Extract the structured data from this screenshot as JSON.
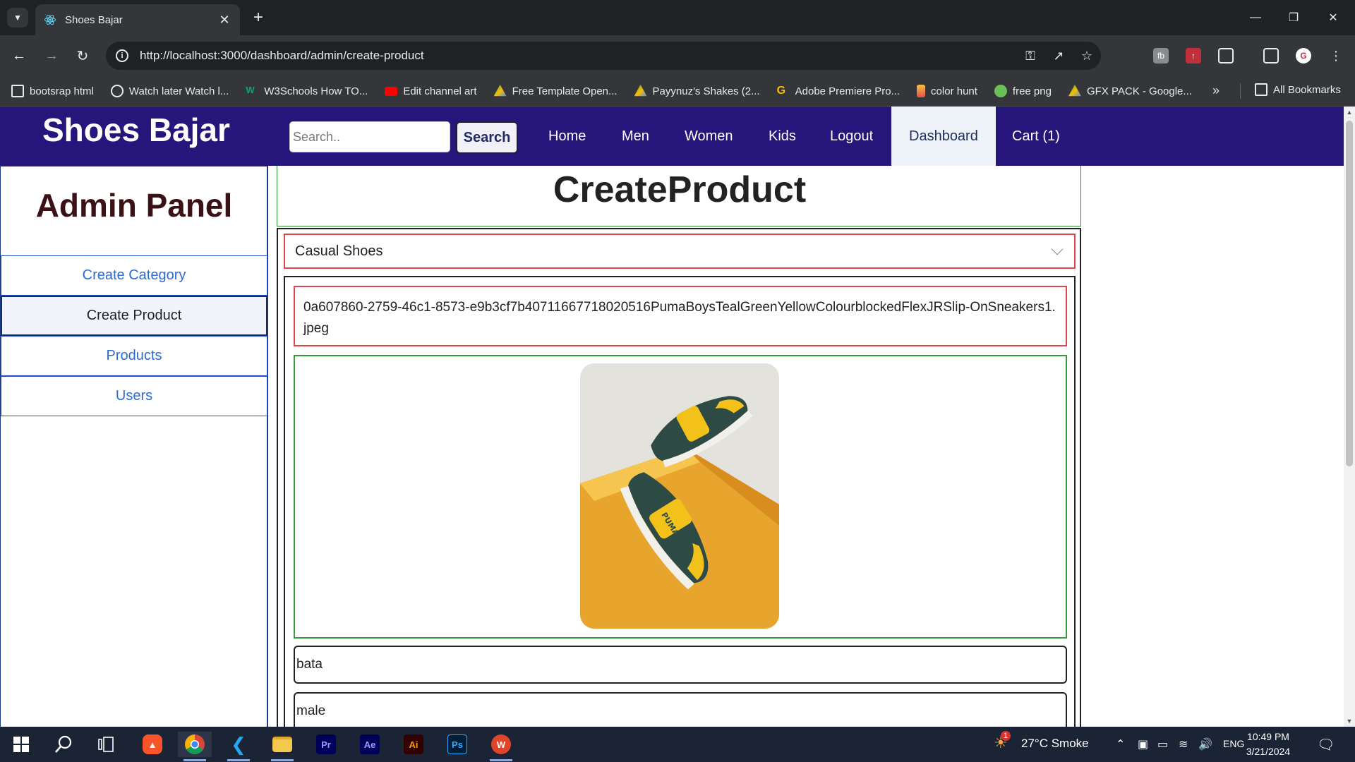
{
  "browser": {
    "tab_title": "Shoes Bajar",
    "url": "http://localhost:3000/dashboard/admin/create-product",
    "bookmarks": [
      "bootsrap html",
      "Watch later Watch l...",
      "W3Schools How TO...",
      "Edit channel art",
      "Free Template Open...",
      "Payynuz's Shakes (2...",
      "Adobe Premiere Pro...",
      "color hunt",
      "free png",
      "GFX PACK - Google..."
    ],
    "all_bookmarks": "All Bookmarks"
  },
  "site": {
    "brand": "Shoes Bajar",
    "search_placeholder": "Search..",
    "search_button": "Search",
    "nav": [
      "Home",
      "Men",
      "Women",
      "Kids",
      "Logout",
      "Dashboard",
      "Cart (1)"
    ],
    "active_nav": "Dashboard"
  },
  "sidebar": {
    "title": "Admin Panel",
    "items": [
      "Create Category",
      "Create Product",
      "Products",
      "Users"
    ],
    "active": "Create Product"
  },
  "main": {
    "title": "CreateProduct",
    "category_selected": "Casual Shoes",
    "file_name": "0a607860-2759-46c1-8573-e9b3cf7b40711667718020516PumaBoysTealGreenYellowColourblockedFlexJRSlip-OnSneakers1.jpeg",
    "field_brand": "bata",
    "field_gender": "male"
  },
  "taskbar": {
    "weather": "27°C  Smoke",
    "weather_badge": "1",
    "language": "ENG",
    "time": "10:49 PM",
    "date": "3/21/2024",
    "apps": [
      "start",
      "search",
      "task-view",
      "brave",
      "chrome",
      "vscode",
      "file-explorer",
      "premiere-pro",
      "after-effects",
      "illustrator",
      "photoshop",
      "wps-office"
    ],
    "app_labels": {
      "premiere": "Pr",
      "after_effects": "Ae",
      "illustrator": "Ai",
      "photoshop": "Ps",
      "wps": "W"
    }
  },
  "colors": {
    "navbar": "#26157a",
    "admin_title": "#3a1216",
    "link_blue": "#2a6bd6",
    "red_border": "#e0434b",
    "green_border": "#2d8a2d"
  }
}
